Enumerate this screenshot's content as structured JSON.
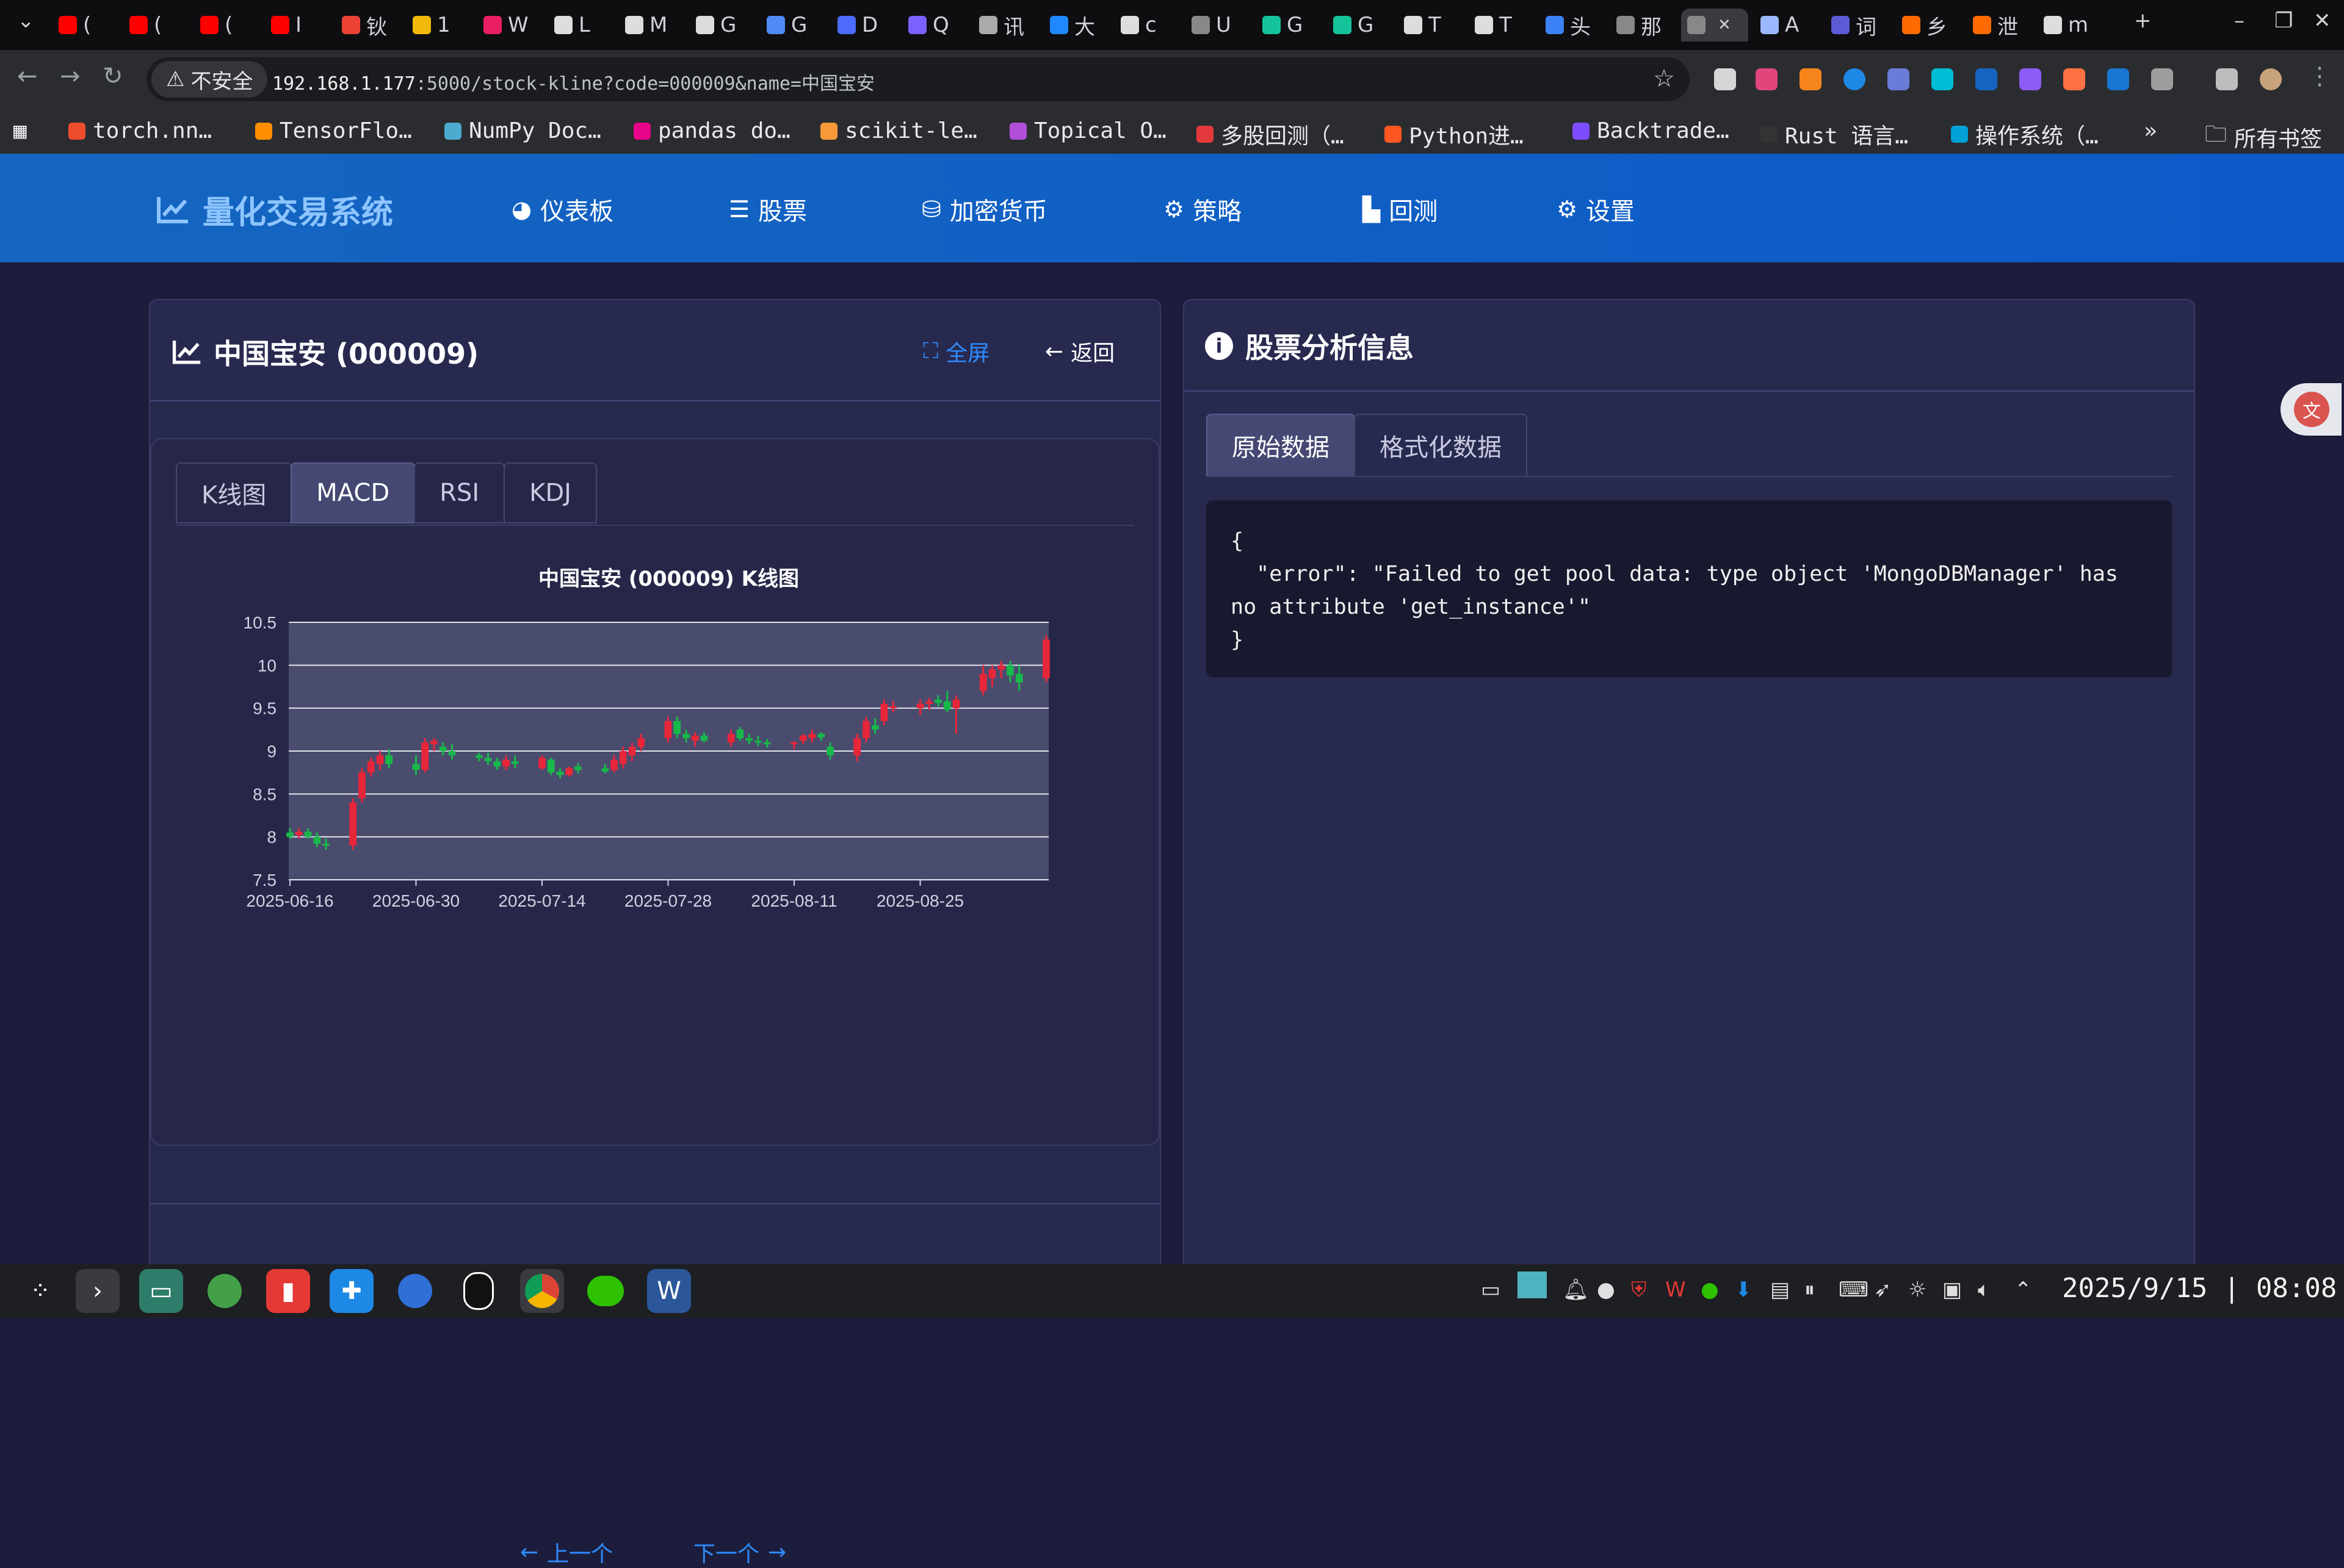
{
  "browser": {
    "tabs": [
      {
        "icon": "youtube-icon",
        "text": "(",
        "color": "#ff0000"
      },
      {
        "icon": "youtube-icon",
        "text": "(",
        "color": "#ff0000"
      },
      {
        "icon": "youtube-icon",
        "text": "(",
        "color": "#ff0000"
      },
      {
        "icon": "youtube-icon",
        "text": "I",
        "color": "#ff0000"
      },
      {
        "icon": "gmail-icon",
        "text": "钬",
        "color": "#ea4335"
      },
      {
        "icon": "binance-icon",
        "text": "1",
        "color": "#f0b90b"
      },
      {
        "icon": "tradingview-icon",
        "text": "W",
        "color": "#e91e63"
      },
      {
        "icon": "openai-icon",
        "text": "L",
        "color": "#dddddd"
      },
      {
        "icon": "slash-icon",
        "text": "M",
        "color": "#dddddd"
      },
      {
        "icon": "github-icon",
        "text": "G",
        "color": "#dddddd"
      },
      {
        "icon": "gemini-icon",
        "text": "G",
        "color": "#4f8bf6"
      },
      {
        "icon": "deepseek-icon",
        "text": "D",
        "color": "#4d6bfe"
      },
      {
        "icon": "star-icon",
        "text": "Q",
        "color": "#7b61ff"
      },
      {
        "icon": "app-icon",
        "text": "讯",
        "color": "#aaaaaa"
      },
      {
        "icon": "app-icon",
        "text": "大",
        "color": "#1f88ff"
      },
      {
        "icon": "terminal-icon",
        "text": "c",
        "color": "#dddddd"
      },
      {
        "icon": "globe-icon",
        "text": "U",
        "color": "#888888"
      },
      {
        "icon": "grammarly-icon",
        "text": "G",
        "color": "#15c39a"
      },
      {
        "icon": "grammarly-icon",
        "text": "G",
        "color": "#15c39a"
      },
      {
        "icon": "github-icon",
        "text": "T",
        "color": "#dddddd"
      },
      {
        "icon": "openai-icon",
        "text": "T",
        "color": "#dddddd"
      },
      {
        "icon": "app-icon",
        "text": "头",
        "color": "#3b82f6"
      },
      {
        "icon": "globe-icon",
        "text": "那",
        "color": "#888888"
      },
      {
        "icon": "globe-icon",
        "text": "",
        "color": "#888888",
        "active": true
      },
      {
        "icon": "book-icon",
        "text": "A",
        "color": "#9bb8ff"
      },
      {
        "icon": "app-icon",
        "text": "词",
        "color": "#5b5bd6"
      },
      {
        "icon": "app-icon",
        "text": "乡",
        "color": "#ff6a00"
      },
      {
        "icon": "app-icon",
        "text": "泄",
        "color": "#ff6a00"
      },
      {
        "icon": "github-icon",
        "text": "m",
        "color": "#dddddd"
      }
    ],
    "new_tab": "+",
    "url_security": "不安全",
    "url_host": "192.168.1.177",
    "url_path": ":5000/stock-kline?code=000009&name=中国宝安",
    "bookmarks": [
      {
        "label": "torch.nn…",
        "color": "#ee4c2c"
      },
      {
        "label": "TensorFlo…",
        "color": "#ff8f00"
      },
      {
        "label": "NumPy Doc…",
        "color": "#4dabcf"
      },
      {
        "label": "pandas do…",
        "color": "#e70488"
      },
      {
        "label": "scikit-le…",
        "color": "#f89939"
      },
      {
        "label": "Topical O…",
        "color": "#b14ed8"
      },
      {
        "label": "多股回测（…",
        "color": "#e4393c"
      },
      {
        "label": "Python进…",
        "color": "#ff5722"
      },
      {
        "label": "Backtrade…",
        "color": "#7c4dff"
      },
      {
        "label": "Rust 语言…",
        "color": "#333333"
      },
      {
        "label": "操作系统（…",
        "color": "#00a1d6"
      }
    ],
    "bookmarks_more": "»",
    "all_bookmarks": "所有书签"
  },
  "nav": {
    "brand": "量化交易系统",
    "items": [
      {
        "label": "仪表板",
        "icon": "dashboard-icon"
      },
      {
        "label": "股票",
        "icon": "list-icon"
      },
      {
        "label": "加密货币",
        "icon": "coins-icon"
      },
      {
        "label": "策略",
        "icon": "cogs-icon"
      },
      {
        "label": "回测",
        "icon": "bar-chart-icon"
      },
      {
        "label": "设置",
        "icon": "gear-icon"
      }
    ]
  },
  "left_card": {
    "title": "中国宝安 (000009)",
    "fullscreen": "全屏",
    "back": "返回",
    "tabs": [
      "K线图",
      "MACD",
      "RSI",
      "KDJ"
    ],
    "active_tab": "MACD",
    "prev": "上一个",
    "next": "下一个"
  },
  "chart_data": {
    "type": "candlestick",
    "title": "中国宝安 (000009) K线图",
    "xlabel": "",
    "ylabel": "",
    "ylim": [
      7.5,
      10.5
    ],
    "y_ticks": [
      "7.5",
      "8",
      "8.5",
      "9",
      "9.5",
      "10",
      "10.5"
    ],
    "x_ticks": [
      "2025-06-16",
      "2025-06-30",
      "2025-07-14",
      "2025-07-28",
      "2025-08-11",
      "2025-08-25"
    ],
    "grid": true,
    "up_color": "#e8263a",
    "down_color": "#18b84b",
    "candles": [
      {
        "date": "2025-06-16",
        "o": 8.05,
        "h": 8.1,
        "l": 7.98,
        "c": 8.0
      },
      {
        "date": "2025-06-17",
        "o": 8.02,
        "h": 8.1,
        "l": 7.98,
        "c": 8.06
      },
      {
        "date": "2025-06-18",
        "o": 8.06,
        "h": 8.1,
        "l": 7.98,
        "c": 8.0
      },
      {
        "date": "2025-06-19",
        "o": 8.0,
        "h": 8.05,
        "l": 7.88,
        "c": 7.92
      },
      {
        "date": "2025-06-20",
        "o": 7.92,
        "h": 7.98,
        "l": 7.85,
        "c": 7.9
      },
      {
        "date": "2025-06-23",
        "o": 7.9,
        "h": 8.45,
        "l": 7.85,
        "c": 8.4
      },
      {
        "date": "2025-06-24",
        "o": 8.45,
        "h": 8.8,
        "l": 8.4,
        "c": 8.75
      },
      {
        "date": "2025-06-25",
        "o": 8.75,
        "h": 8.92,
        "l": 8.7,
        "c": 8.88
      },
      {
        "date": "2025-06-26",
        "o": 8.85,
        "h": 9.0,
        "l": 8.78,
        "c": 8.95
      },
      {
        "date": "2025-06-27",
        "o": 8.95,
        "h": 9.02,
        "l": 8.8,
        "c": 8.85
      },
      {
        "date": "2025-06-30",
        "o": 8.85,
        "h": 8.95,
        "l": 8.72,
        "c": 8.78
      },
      {
        "date": "2025-07-01",
        "o": 8.78,
        "h": 9.15,
        "l": 8.75,
        "c": 9.1
      },
      {
        "date": "2025-07-02",
        "o": 9.08,
        "h": 9.15,
        "l": 9.0,
        "c": 9.12
      },
      {
        "date": "2025-07-03",
        "o": 9.05,
        "h": 9.1,
        "l": 8.95,
        "c": 9.0
      },
      {
        "date": "2025-07-04",
        "o": 9.0,
        "h": 9.08,
        "l": 8.9,
        "c": 8.95
      },
      {
        "date": "2025-07-07",
        "o": 8.95,
        "h": 8.98,
        "l": 8.88,
        "c": 8.92
      },
      {
        "date": "2025-07-08",
        "o": 8.92,
        "h": 8.98,
        "l": 8.84,
        "c": 8.88
      },
      {
        "date": "2025-07-09",
        "o": 8.88,
        "h": 8.92,
        "l": 8.78,
        "c": 8.82
      },
      {
        "date": "2025-07-10",
        "o": 8.82,
        "h": 8.95,
        "l": 8.78,
        "c": 8.9
      },
      {
        "date": "2025-07-11",
        "o": 8.88,
        "h": 8.95,
        "l": 8.8,
        "c": 8.85
      },
      {
        "date": "2025-07-14",
        "o": 8.8,
        "h": 8.95,
        "l": 8.78,
        "c": 8.92
      },
      {
        "date": "2025-07-15",
        "o": 8.9,
        "h": 8.92,
        "l": 8.72,
        "c": 8.75
      },
      {
        "date": "2025-07-16",
        "o": 8.76,
        "h": 8.8,
        "l": 8.68,
        "c": 8.72
      },
      {
        "date": "2025-07-17",
        "o": 8.72,
        "h": 8.82,
        "l": 8.7,
        "c": 8.8
      },
      {
        "date": "2025-07-18",
        "o": 8.82,
        "h": 8.86,
        "l": 8.74,
        "c": 8.78
      },
      {
        "date": "2025-07-21",
        "o": 8.8,
        "h": 8.85,
        "l": 8.74,
        "c": 8.76
      },
      {
        "date": "2025-07-22",
        "o": 8.78,
        "h": 8.95,
        "l": 8.75,
        "c": 8.9
      },
      {
        "date": "2025-07-23",
        "o": 8.85,
        "h": 9.05,
        "l": 8.8,
        "c": 9.0
      },
      {
        "date": "2025-07-24",
        "o": 8.95,
        "h": 9.1,
        "l": 8.88,
        "c": 9.05
      },
      {
        "date": "2025-07-25",
        "o": 9.05,
        "h": 9.2,
        "l": 9.0,
        "c": 9.15
      },
      {
        "date": "2025-07-28",
        "o": 9.15,
        "h": 9.4,
        "l": 9.1,
        "c": 9.35
      },
      {
        "date": "2025-07-29",
        "o": 9.35,
        "h": 9.4,
        "l": 9.15,
        "c": 9.2
      },
      {
        "date": "2025-07-30",
        "o": 9.2,
        "h": 9.25,
        "l": 9.1,
        "c": 9.15
      },
      {
        "date": "2025-07-31",
        "o": 9.12,
        "h": 9.22,
        "l": 9.05,
        "c": 9.18
      },
      {
        "date": "2025-08-01",
        "o": 9.18,
        "h": 9.22,
        "l": 9.1,
        "c": 9.12
      },
      {
        "date": "2025-08-04",
        "o": 9.1,
        "h": 9.25,
        "l": 9.05,
        "c": 9.2
      },
      {
        "date": "2025-08-05",
        "o": 9.25,
        "h": 9.28,
        "l": 9.12,
        "c": 9.15
      },
      {
        "date": "2025-08-06",
        "o": 9.15,
        "h": 9.2,
        "l": 9.08,
        "c": 9.12
      },
      {
        "date": "2025-08-07",
        "o": 9.12,
        "h": 9.18,
        "l": 9.06,
        "c": 9.1
      },
      {
        "date": "2025-08-08",
        "o": 9.1,
        "h": 9.14,
        "l": 9.04,
        "c": 9.08
      },
      {
        "date": "2025-08-11",
        "o": 9.08,
        "h": 9.12,
        "l": 9.02,
        "c": 9.1
      },
      {
        "date": "2025-08-12",
        "o": 9.12,
        "h": 9.2,
        "l": 9.08,
        "c": 9.18
      },
      {
        "date": "2025-08-13",
        "o": 9.15,
        "h": 9.25,
        "l": 9.1,
        "c": 9.2
      },
      {
        "date": "2025-08-14",
        "o": 9.2,
        "h": 9.22,
        "l": 9.12,
        "c": 9.16
      },
      {
        "date": "2025-08-15",
        "o": 9.05,
        "h": 9.1,
        "l": 8.9,
        "c": 8.95
      },
      {
        "date": "2025-08-18",
        "o": 8.95,
        "h": 9.2,
        "l": 8.88,
        "c": 9.15
      },
      {
        "date": "2025-08-19",
        "o": 9.15,
        "h": 9.4,
        "l": 9.1,
        "c": 9.35
      },
      {
        "date": "2025-08-20",
        "o": 9.3,
        "h": 9.38,
        "l": 9.2,
        "c": 9.25
      },
      {
        "date": "2025-08-21",
        "o": 9.35,
        "h": 9.6,
        "l": 9.3,
        "c": 9.55
      },
      {
        "date": "2025-08-22",
        "o": 9.5,
        "h": 9.58,
        "l": 9.45,
        "c": 9.52
      },
      {
        "date": "2025-08-25",
        "o": 9.5,
        "h": 9.6,
        "l": 9.42,
        "c": 9.55
      },
      {
        "date": "2025-08-26",
        "o": 9.55,
        "h": 9.62,
        "l": 9.48,
        "c": 9.58
      },
      {
        "date": "2025-08-27",
        "o": 9.6,
        "h": 9.65,
        "l": 9.52,
        "c": 9.56
      },
      {
        "date": "2025-08-28",
        "o": 9.58,
        "h": 9.7,
        "l": 9.45,
        "c": 9.48
      },
      {
        "date": "2025-08-29",
        "o": 9.5,
        "h": 9.65,
        "l": 9.2,
        "c": 9.6
      },
      {
        "date": "2025-09-01",
        "o": 9.7,
        "h": 10.0,
        "l": 9.65,
        "c": 9.9
      },
      {
        "date": "2025-09-02",
        "o": 9.85,
        "h": 10.0,
        "l": 9.75,
        "c": 9.95
      },
      {
        "date": "2025-09-03",
        "o": 9.95,
        "h": 10.05,
        "l": 9.85,
        "c": 10.0
      },
      {
        "date": "2025-09-04",
        "o": 10.0,
        "h": 10.05,
        "l": 9.8,
        "c": 9.88
      },
      {
        "date": "2025-09-05",
        "o": 9.9,
        "h": 10.0,
        "l": 9.7,
        "c": 9.8
      },
      {
        "date": "2025-09-08",
        "o": 9.85,
        "h": 10.35,
        "l": 9.8,
        "c": 10.3
      }
    ]
  },
  "right_card": {
    "title": "股票分析信息",
    "tabs": [
      "原始数据",
      "格式化数据"
    ],
    "active_tab": "原始数据",
    "raw_json": "{\n  \"error\": \"Failed to get pool data: type object 'MongoDBManager' has no attribute 'get_instance'\"\n}"
  },
  "taskbar": {
    "date": "2025/9/15",
    "time": "08:08",
    "separator": "|"
  }
}
